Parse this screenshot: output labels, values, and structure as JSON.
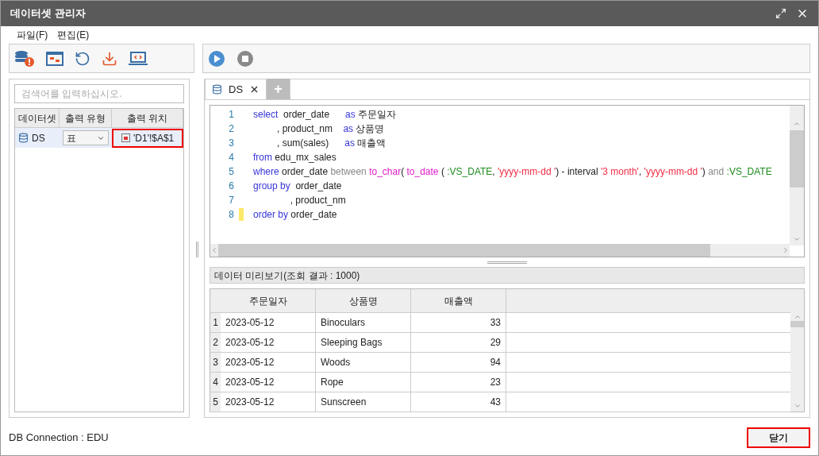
{
  "window": {
    "title": "데이터셋 관리자"
  },
  "menu": [
    "파일(F)",
    "편집(E)"
  ],
  "left": {
    "search": {
      "placeholder": "검색어를 입력하십시오."
    },
    "columns": [
      "데이터셋",
      "출력 유형",
      "출력 위치"
    ],
    "rows": [
      {
        "name": "DS",
        "type": "표",
        "location": "'D1'!$A$1",
        "selected": true
      }
    ]
  },
  "tabs": [
    {
      "label": "DS",
      "selected": true
    }
  ],
  "add_tab": "+",
  "code": [
    {
      "number": "1",
      "marked": false,
      "tokens": [
        {
          "kind": "keyword",
          "text": "select  "
        },
        {
          "kind": "plain",
          "text": "order_date      "
        },
        {
          "kind": "keyword",
          "text": "as "
        },
        {
          "kind": "plain",
          "text": "주문일자"
        }
      ]
    },
    {
      "number": "2",
      "marked": false,
      "tokens": [
        {
          "kind": "plain",
          "text": "         , product_nm    "
        },
        {
          "kind": "keyword",
          "text": "as "
        },
        {
          "kind": "plain",
          "text": "상품명"
        }
      ]
    },
    {
      "number": "3",
      "marked": false,
      "tokens": [
        {
          "kind": "plain",
          "text": "         , sum(sales)      "
        },
        {
          "kind": "keyword",
          "text": "as "
        },
        {
          "kind": "plain",
          "text": "매출액"
        }
      ]
    },
    {
      "number": "4",
      "marked": false,
      "tokens": [
        {
          "kind": "keyword",
          "text": "from "
        },
        {
          "kind": "plain",
          "text": "edu_mx_sales"
        }
      ]
    },
    {
      "number": "5",
      "marked": false,
      "tokens": [
        {
          "kind": "keyword",
          "text": "where "
        },
        {
          "kind": "plain",
          "text": "order_date "
        },
        {
          "kind": "operator",
          "text": "between "
        },
        {
          "kind": "function",
          "text": "to_char"
        },
        {
          "kind": "plain",
          "text": "( "
        },
        {
          "kind": "function",
          "text": "to_date "
        },
        {
          "kind": "plain",
          "text": "( "
        },
        {
          "kind": "parameter",
          "text": ":VS_DATE"
        },
        {
          "kind": "plain",
          "text": ", "
        },
        {
          "kind": "string",
          "text": "'yyyy-mm-dd '"
        },
        {
          "kind": "plain",
          "text": ") - interval "
        },
        {
          "kind": "string",
          "text": "'3 month'"
        },
        {
          "kind": "plain",
          "text": ", "
        },
        {
          "kind": "string",
          "text": "'yyyy-mm-dd '"
        },
        {
          "kind": "plain",
          "text": ") "
        },
        {
          "kind": "operator",
          "text": "and "
        },
        {
          "kind": "parameter",
          "text": ":VS_DATE"
        }
      ]
    },
    {
      "number": "6",
      "marked": false,
      "tokens": [
        {
          "kind": "keyword",
          "text": "group by  "
        },
        {
          "kind": "plain",
          "text": "order_date"
        }
      ]
    },
    {
      "number": "7",
      "marked": false,
      "tokens": [
        {
          "kind": "plain",
          "text": "              , product_nm"
        }
      ]
    },
    {
      "number": "8",
      "marked": true,
      "tokens": [
        {
          "kind": "keyword",
          "text": "order by "
        },
        {
          "kind": "plain",
          "text": "order_date"
        }
      ]
    }
  ],
  "preview": {
    "title": "데이터 미리보기(조회 결과 : 1000)",
    "columns": [
      "주문일자",
      "상품명",
      "매출액"
    ],
    "rows": [
      {
        "number": "1",
        "cells": [
          "2023-05-12",
          "Binoculars",
          "33"
        ]
      },
      {
        "number": "2",
        "cells": [
          "2023-05-12",
          "Sleeping Bags",
          "29"
        ]
      },
      {
        "number": "3",
        "cells": [
          "2023-05-12",
          "Woods",
          "94"
        ]
      },
      {
        "number": "4",
        "cells": [
          "2023-05-12",
          "Rope",
          "23"
        ]
      },
      {
        "number": "5",
        "cells": [
          "2023-05-12",
          "Sunscreen",
          "43"
        ]
      }
    ]
  },
  "status": "DB Connection : EDU",
  "close_button": "닫기"
}
